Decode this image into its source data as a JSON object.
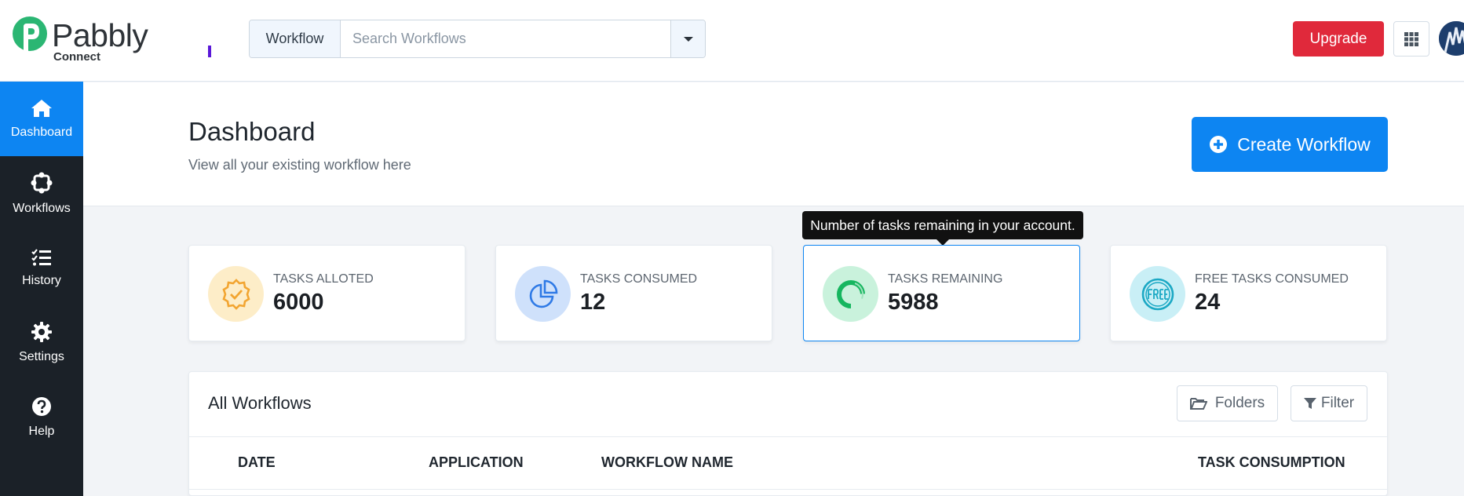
{
  "header": {
    "logo_name": "Pabbly",
    "logo_sub": "Connect",
    "search_prefix": "Workflow",
    "search_placeholder": "Search Workflows",
    "upgrade_label": "Upgrade",
    "colors": {
      "brand_green": "#2bb673",
      "accent_blue": "#0d85f2",
      "upgrade_red": "#e0293b"
    }
  },
  "sidebar": {
    "items": [
      {
        "label": "Dashboard",
        "icon": "home-icon",
        "active": true
      },
      {
        "label": "Workflows",
        "icon": "workflows-icon",
        "active": false
      },
      {
        "label": "History",
        "icon": "history-icon",
        "active": false
      },
      {
        "label": "Settings",
        "icon": "gear-icon",
        "active": false
      },
      {
        "label": "Help",
        "icon": "help-icon",
        "active": false
      }
    ]
  },
  "page": {
    "title": "Dashboard",
    "subtitle": "View all your existing workflow here",
    "create_label": "Create Workflow"
  },
  "tooltip": {
    "text": "Number of tasks remaining in your account."
  },
  "stats": [
    {
      "label": "TASKS ALLOTED",
      "value": "6000",
      "icon": "badge-check-icon"
    },
    {
      "label": "TASKS CONSUMED",
      "value": "12",
      "icon": "pie-chart-icon"
    },
    {
      "label": "TASKS REMAINING",
      "value": "5988",
      "icon": "donut-icon"
    },
    {
      "label": "FREE TASKS CONSUMED",
      "value": "24",
      "icon": "free-badge-icon"
    }
  ],
  "workflows": {
    "title": "All Workflows",
    "folders_label": "Folders",
    "filter_label": "Filter",
    "columns": [
      "DATE",
      "APPLICATION",
      "WORKFLOW NAME",
      "TASK CONSUMPTION"
    ]
  }
}
